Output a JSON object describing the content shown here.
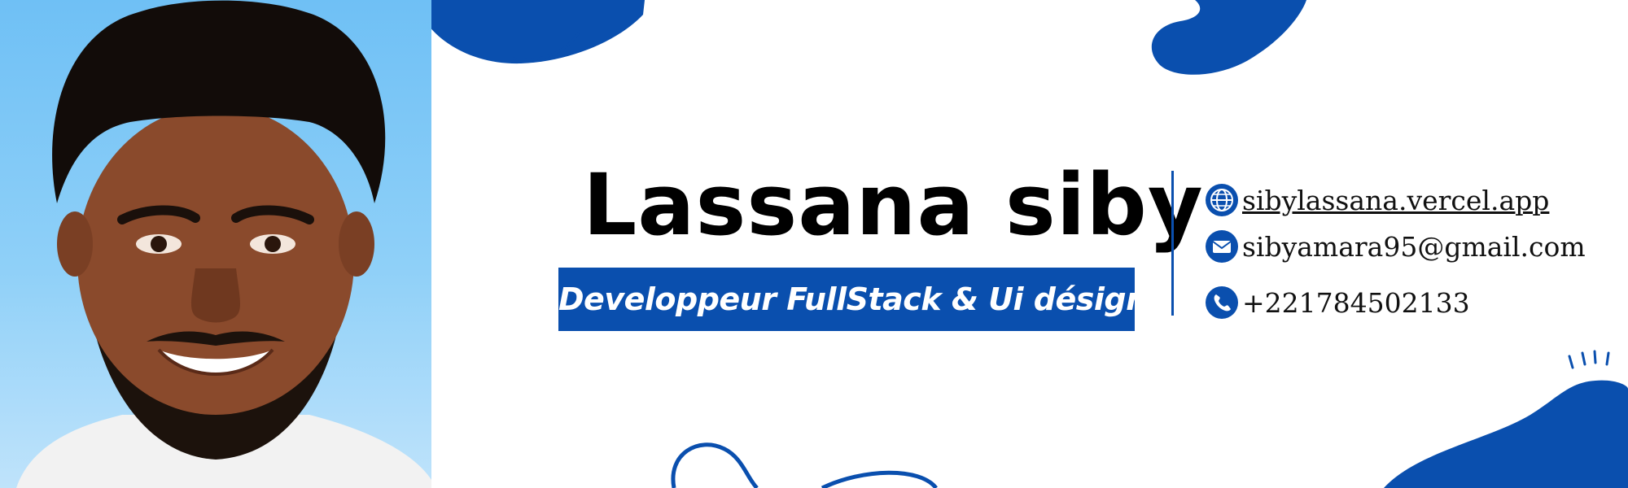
{
  "profile": {
    "name": "Lassana siby",
    "title": "Developpeur FullStack & Ui désigner"
  },
  "contacts": [
    {
      "icon": "globe-icon",
      "text": "sibylassana.vercel.app"
    },
    {
      "icon": "mail-icon",
      "text": "sibyamara95@gmail.com"
    },
    {
      "icon": "phone-icon",
      "text": "+221784502133"
    }
  ],
  "colors": {
    "accent": "#0a4fae",
    "background": "#ffffff",
    "photo_sky": "#6fc0f5",
    "text": "#000000"
  }
}
